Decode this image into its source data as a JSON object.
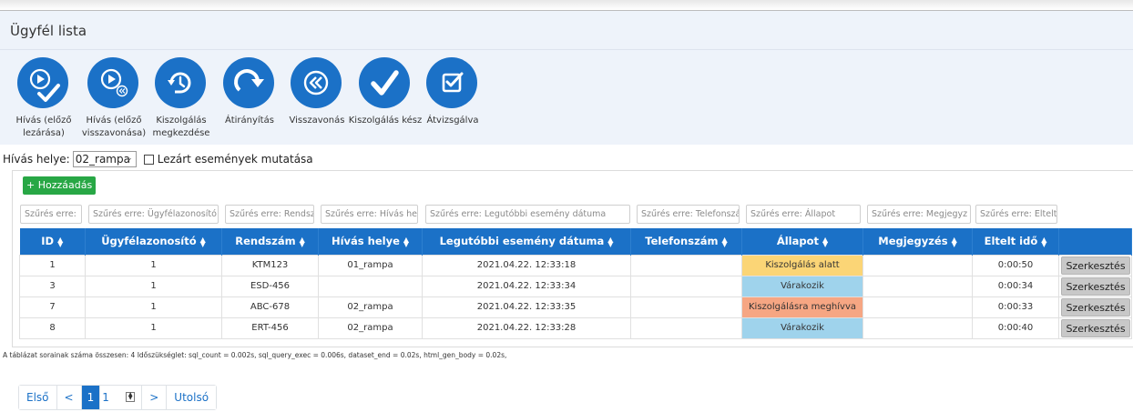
{
  "window": {
    "title": "Ügyfél lista"
  },
  "toolbar": {
    "buttons": [
      {
        "label": "Hívás (előző lezárása)",
        "icon": "play-check-icon"
      },
      {
        "label": "Hívás (előző visszavonása)",
        "icon": "play-rewind-icon"
      },
      {
        "label": "Kiszolgálás megkezdése",
        "icon": "clock-cycle-icon"
      },
      {
        "label": "Átirányítás",
        "icon": "redirect-arrow-icon"
      },
      {
        "label": "Visszavonás",
        "icon": "rewind-icon"
      },
      {
        "label": "Kiszolgálás kész",
        "icon": "check-icon"
      },
      {
        "label": "Átvizsgálva",
        "icon": "checkbox-checked-icon"
      }
    ]
  },
  "filter_bar": {
    "location_label": "Hívás helye:",
    "location_value": "02_rampa",
    "show_closed_label": "Lezárt események mutatása",
    "show_closed_checked": false
  },
  "add_button": {
    "label": "+ Hozzáadás"
  },
  "column_filters": [
    "Szűrés erre:",
    "Szűrés erre: Ügyfélazonosító",
    "Szűrés erre: Rendsz",
    "Szűrés erre: Hívás he",
    "Szűrés erre: Legutóbbi esemény dátuma",
    "Szűrés erre: Telefonszá",
    "Szűrés erre: Állapot",
    "Szűrés erre: Megjegyz",
    "Szűrés erre: Eltelt"
  ],
  "table": {
    "headers": [
      "ID",
      "Ügyfélazonosító",
      "Rendszám",
      "Hívás helye",
      "Legutóbbi esemény dátuma",
      "Telefonszám",
      "Állapot",
      "Megjegyzés",
      "Eltelt idő"
    ],
    "edit_label": "Szerkesztés",
    "rows": [
      {
        "id": "1",
        "customer": "1",
        "plate": "KTM123",
        "location": "01_rampa",
        "date": "2021.04.22. 12:33:18",
        "phone": "",
        "status": "Kiszolgálás alatt",
        "status_color": "#fbd576",
        "note": "",
        "elapsed": "0:00:50"
      },
      {
        "id": "3",
        "customer": "1",
        "plate": "ESD-456",
        "location": "",
        "date": "2021.04.22. 12:33:34",
        "phone": "",
        "status": "Várakozik",
        "status_color": "#9fd3ec",
        "note": "",
        "elapsed": "0:00:34"
      },
      {
        "id": "7",
        "customer": "1",
        "plate": "ABC-678",
        "location": "02_rampa",
        "date": "2021.04.22. 12:33:35",
        "phone": "",
        "status": "Kiszolgálásra meghívva",
        "status_color": "#f6a683",
        "note": "",
        "elapsed": "0:00:33"
      },
      {
        "id": "8",
        "customer": "1",
        "plate": "ERT-456",
        "location": "02_rampa",
        "date": "2021.04.22. 12:33:28",
        "phone": "",
        "status": "Várakozik",
        "status_color": "#9fd3ec",
        "note": "",
        "elapsed": "0:00:40"
      }
    ]
  },
  "stats_text": "A táblázat sorainak száma összesen: 4   Időszükséglet: sql_count = 0.002s, sql_query_exec = 0.006s, dataset_end = 0.02s, html_gen_body = 0.02s,",
  "pager": {
    "first": "Első",
    "prev": "<",
    "current": "1",
    "page_input": "1",
    "next": ">",
    "last": "Utolsó"
  },
  "colors": {
    "primary": "#1b71c7",
    "add_button": "#28a745",
    "toolbar_bg": "#eef3fa"
  }
}
